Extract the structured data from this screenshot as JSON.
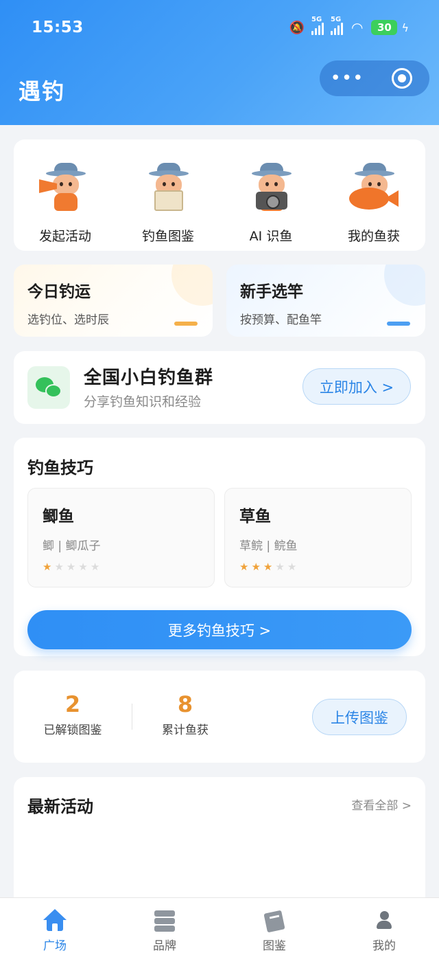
{
  "status_bar": {
    "time": "15:53",
    "network_1": "5G",
    "network_2": "5G",
    "battery": "30"
  },
  "app": {
    "title": "遇钓"
  },
  "capsule": {
    "more_icon": "•••",
    "target_icon": "target-icon"
  },
  "quick_actions": [
    {
      "label": "发起活动",
      "icon": "mascot-megaphone-icon"
    },
    {
      "label": "钓鱼图鉴",
      "icon": "mascot-book-icon"
    },
    {
      "label": "AI 识鱼",
      "icon": "mascot-camera-icon"
    },
    {
      "label": "我的鱼获",
      "icon": "mascot-fish-icon"
    }
  ],
  "tools": [
    {
      "title": "今日钓运",
      "subtitle": "选钓位、选时辰",
      "accent": "#f5b04a"
    },
    {
      "title": "新手选竿",
      "subtitle": "按预算、配鱼竿",
      "accent": "#4d9ff2"
    }
  ],
  "group": {
    "title": "全国小白钓鱼群",
    "subtitle": "分享钓鱼知识和经验",
    "join_label": "立即加入 >",
    "icon": "wechat-icon"
  },
  "tips": {
    "title": "钓鱼技巧",
    "fish": [
      {
        "name": "鲫鱼",
        "alias": "鲫 | 鲫瓜子",
        "rating": 1,
        "max_rating": 5
      },
      {
        "name": "草鱼",
        "alias": "草鲩 | 鲩鱼",
        "rating": 3,
        "max_rating": 5
      }
    ],
    "more_label": "更多钓鱼技巧 >"
  },
  "stats": {
    "unlocked_value": "2",
    "unlocked_label": "已解锁图鉴",
    "catch_value": "8",
    "catch_label": "累计鱼获",
    "upload_label": "上传图鉴",
    "accent": "#e8922f"
  },
  "activity": {
    "title": "最新活动",
    "view_all": "查看全部 >"
  },
  "tabbar": [
    {
      "label": "广场",
      "icon": "home-icon",
      "active": true
    },
    {
      "label": "品牌",
      "icon": "stack-icon",
      "active": false
    },
    {
      "label": "图鉴",
      "icon": "book-icon",
      "active": false
    },
    {
      "label": "我的",
      "icon": "person-icon",
      "active": false
    }
  ],
  "colors": {
    "primary": "#2f8ff5",
    "background": "#f2f4f7"
  }
}
